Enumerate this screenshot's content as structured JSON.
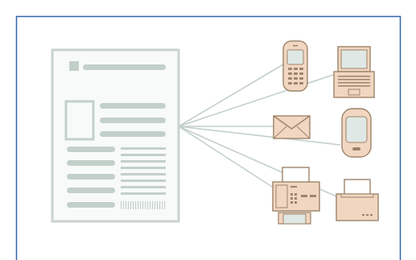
{
  "colors": {
    "frame_border": "#2f66a8",
    "doc_outline": "#c8d3cd",
    "doc_fill": "#f8faf9",
    "doc_bar": "#c3d0ca",
    "connector": "#c3d0ca",
    "device_fill": "#f1d7c2",
    "device_stroke": "#9e8369",
    "screen_fill": "#dfe8e4",
    "paper_fill": "#ffffff"
  },
  "diagram": {
    "source": {
      "icon": "document-icon"
    },
    "targets": [
      {
        "icon": "mobile-phone-icon"
      },
      {
        "icon": "laptop-icon"
      },
      {
        "icon": "email-envelope-icon"
      },
      {
        "icon": "pda-handheld-icon"
      },
      {
        "icon": "fax-machine-icon"
      },
      {
        "icon": "printer-icon"
      }
    ]
  }
}
